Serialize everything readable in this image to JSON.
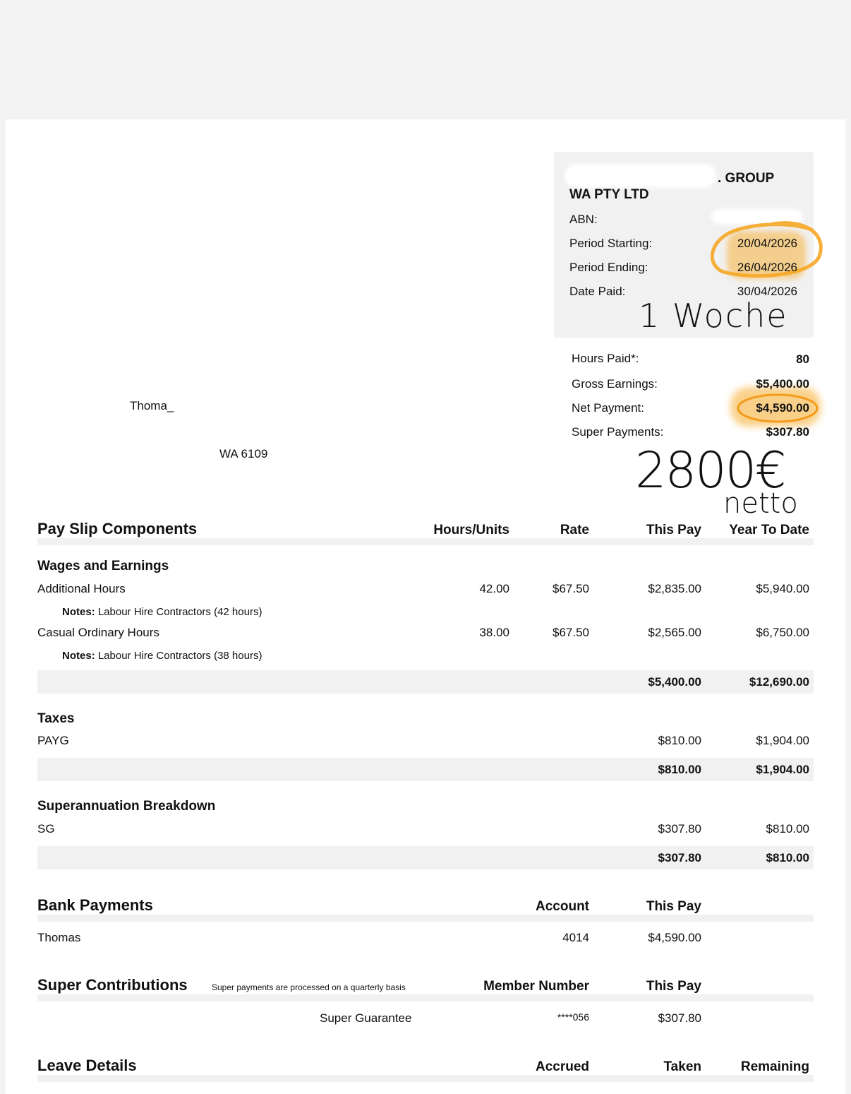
{
  "employer": {
    "name_line1_suffix": ". GROUP",
    "name_line2": "WA PTY LTD",
    "abn_label": "ABN:",
    "period_starting_label": "Period Starting:",
    "period_starting": "20/04/2026",
    "period_ending_label": "Period Ending:",
    "period_ending": "26/04/2026",
    "date_paid_label": "Date Paid:",
    "date_paid": "30/04/2026"
  },
  "employee": {
    "name": "Thoma_",
    "postcode_line": "WA 6109"
  },
  "summary": {
    "hours_label": "Hours Paid*:",
    "hours": "80",
    "gross_label": "Gross Earnings:",
    "gross": "$5,400.00",
    "net_label": "Net Payment:",
    "net": "$4,590.00",
    "super_label": "Super Payments:",
    "super": "$307.80"
  },
  "annotations": {
    "week": "1 Woche",
    "net_eur": "2800€",
    "netto": "netto"
  },
  "components": {
    "title": "Pay Slip Components",
    "col_hours": "Hours/Units",
    "col_rate": "Rate",
    "col_this_pay": "This Pay",
    "col_ytd": "Year To Date",
    "wages": {
      "title": "Wages and Earnings",
      "rows": [
        {
          "label": "Additional Hours",
          "hours": "42.00",
          "rate": "$67.50",
          "this_pay": "$2,835.00",
          "ytd": "$5,940.00",
          "notes_label": "Notes:",
          "notes": "Labour Hire Contractors (42 hours)"
        },
        {
          "label": "Casual Ordinary Hours",
          "hours": "38.00",
          "rate": "$67.50",
          "this_pay": "$2,565.00",
          "ytd": "$6,750.00",
          "notes_label": "Notes:",
          "notes": "Labour Hire Contractors (38 hours)"
        }
      ],
      "total_this_pay": "$5,400.00",
      "total_ytd": "$12,690.00"
    },
    "taxes": {
      "title": "Taxes",
      "rows": [
        {
          "label": "PAYG",
          "this_pay": "$810.00",
          "ytd": "$1,904.00"
        }
      ],
      "total_this_pay": "$810.00",
      "total_ytd": "$1,904.00"
    },
    "super": {
      "title": "Superannuation Breakdown",
      "rows": [
        {
          "label": "SG",
          "this_pay": "$307.80",
          "ytd": "$810.00"
        }
      ],
      "total_this_pay": "$307.80",
      "total_ytd": "$810.00"
    }
  },
  "bank": {
    "title": "Bank Payments",
    "col_account": "Account",
    "col_this_pay": "This Pay",
    "rows": [
      {
        "name": "Thomas",
        "account": "4014",
        "this_pay": "$4,590.00"
      }
    ]
  },
  "super_contrib": {
    "title": "Super Contributions",
    "note": "Super payments are processed on a quarterly basis",
    "col_member": "Member Number",
    "col_this_pay": "This Pay",
    "rows": [
      {
        "type": "Super Guarantee",
        "member": "****056",
        "this_pay": "$307.80"
      }
    ]
  },
  "leave": {
    "title": "Leave Details",
    "col_accrued": "Accrued",
    "col_taken": "Taken",
    "col_remaining": "Remaining"
  },
  "colors": {
    "highlight": "#f7b23b",
    "panel": "#f1f1f1"
  }
}
